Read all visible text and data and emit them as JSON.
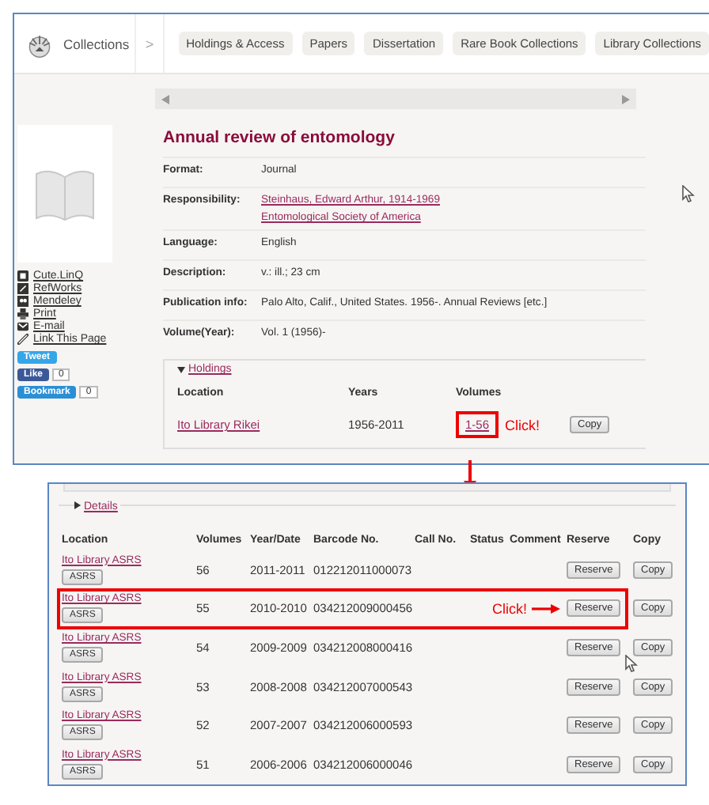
{
  "header": {
    "logo_text": "Collections",
    "separator": ">",
    "tabs": [
      "Holdings & Access",
      "Papers",
      "Dissertation",
      "Rare Book Collections",
      "Library Collections"
    ]
  },
  "sidebar": {
    "links": [
      {
        "kind": "cutelinq",
        "label": "Cute.LinQ"
      },
      {
        "kind": "refworks",
        "label": "RefWorks"
      },
      {
        "kind": "mendeley",
        "label": "Mendeley"
      },
      {
        "kind": "print",
        "label": "Print"
      },
      {
        "kind": "email",
        "label": "E-mail"
      },
      {
        "kind": "link",
        "label": "Link This Page"
      }
    ],
    "share": [
      {
        "kind": "tweet",
        "label": "Tweet"
      },
      {
        "kind": "like",
        "label": "Like",
        "count": "0"
      },
      {
        "kind": "bookmark",
        "label": "Bookmark",
        "count": "0"
      }
    ]
  },
  "record": {
    "title": "Annual review of entomology",
    "fields": [
      {
        "label": "Format:",
        "values": [
          {
            "text": "Journal",
            "link": false
          }
        ]
      },
      {
        "label": "Responsibility:",
        "values": [
          {
            "text": "Steinhaus, Edward Arthur, 1914-1969",
            "link": true
          },
          {
            "text": "Entomological Society of America",
            "link": true
          }
        ]
      },
      {
        "label": "Language:",
        "values": [
          {
            "text": "English",
            "link": false
          }
        ]
      },
      {
        "label": "Description:",
        "values": [
          {
            "text": "v.: ill.; 23 cm",
            "link": false
          }
        ]
      },
      {
        "label": "Publication info:",
        "values": [
          {
            "text": "Palo Alto, Calif., United States. 1956-. Annual Reviews [etc.]",
            "link": false
          }
        ]
      },
      {
        "label": "Volume(Year):",
        "values": [
          {
            "text": "Vol. 1 (1956)-",
            "link": false
          }
        ]
      }
    ]
  },
  "holdings": {
    "legend": "Holdings",
    "columns": [
      "Location",
      "Years",
      "Volumes"
    ],
    "rows": [
      {
        "location": "Ito Library Rikei",
        "years": "1956-2011",
        "volumes": "1-56",
        "copy": "Copy",
        "highlighted": true,
        "callout": "Click!"
      }
    ]
  },
  "details": {
    "legend": "Details",
    "columns": [
      "Location",
      "Volumes",
      "Year/Date",
      "Barcode No.",
      "Call No.",
      "Status",
      "Comment",
      "Reserve",
      "Copy"
    ],
    "rows": [
      {
        "location": "Ito Library ASRS",
        "tag": "ASRS",
        "volumes": "56",
        "year": "2011-2011",
        "barcode": "012212011000073",
        "reserve": "Reserve",
        "copy": "Copy",
        "highlighted": false
      },
      {
        "location": "Ito Library ASRS",
        "tag": "ASRS",
        "volumes": "55",
        "year": "2010-2010",
        "barcode": "034212009000456",
        "reserve": "Reserve",
        "copy": "Copy",
        "highlighted": true,
        "callout": "Click!"
      },
      {
        "location": "Ito Library ASRS",
        "tag": "ASRS",
        "volumes": "54",
        "year": "2009-2009",
        "barcode": "034212008000416",
        "reserve": "Reserve",
        "copy": "Copy",
        "highlighted": false
      },
      {
        "location": "Ito Library ASRS",
        "tag": "ASRS",
        "volumes": "53",
        "year": "2008-2008",
        "barcode": "034212007000543",
        "reserve": "Reserve",
        "copy": "Copy",
        "highlighted": false
      },
      {
        "location": "Ito Library ASRS",
        "tag": "ASRS",
        "volumes": "52",
        "year": "2007-2007",
        "barcode": "034212006000593",
        "reserve": "Reserve",
        "copy": "Copy",
        "highlighted": false
      },
      {
        "location": "Ito Library ASRS",
        "tag": "ASRS",
        "volumes": "51",
        "year": "2006-2006",
        "barcode": "034212006000046",
        "reserve": "Reserve",
        "copy": "Copy",
        "highlighted": false
      }
    ]
  }
}
